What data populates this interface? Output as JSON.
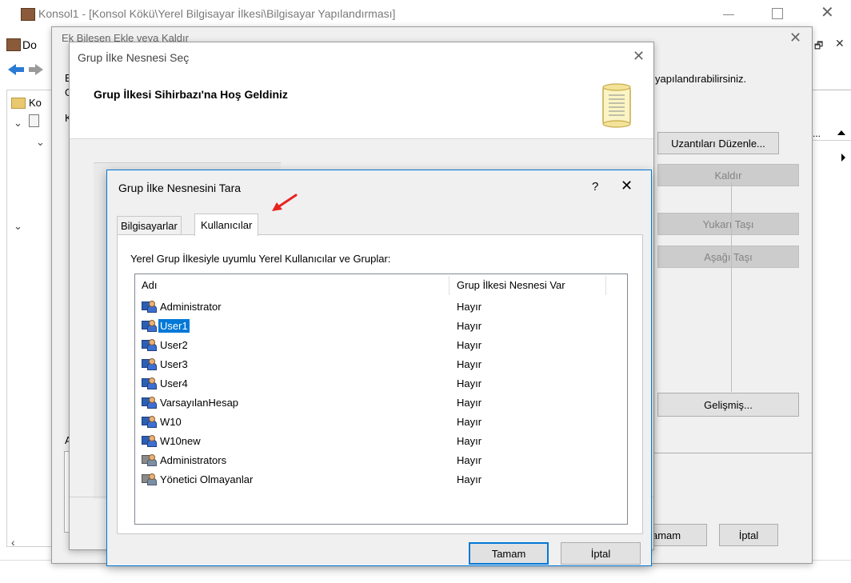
{
  "main_window": {
    "title": "Konsol1 - [Konsol Kökü\\Yerel Bilgisayar İlkesi\\Bilgisayar Yapılandırması]",
    "menu_first": "Do",
    "tree_item": "Ko",
    "col_trunc": "...",
    "right_partial_text": "yapılandırabilirsiniz."
  },
  "add_remove_dialog": {
    "title": "Ek Bileşen Ekle veya Kaldır",
    "left_letter_e": "E",
    "left_letter_g": "G",
    "left_letter_k": "K",
    "left_letter_a": "A",
    "buttons": {
      "edit_extensions": "Uzantıları Düzenle...",
      "remove": "Kaldır",
      "move_up": "Yukarı Taşı",
      "move_down": "Aşağı Taşı",
      "advanced": "Gelişmiş...",
      "ok_partial": "amam",
      "cancel": "İptal"
    }
  },
  "gpo_select_dialog": {
    "title": "Grup İlke Nesnesi Seç",
    "heading": "Grup İlkesi Sihirbazı'na Hoş Geldiniz"
  },
  "browse_dialog": {
    "title": "Grup İlke Nesnesini Tara",
    "help": "?",
    "tabs": [
      {
        "label": "Bilgisayarlar",
        "active": false
      },
      {
        "label": "Kullanıcılar",
        "active": true
      }
    ],
    "list_caption": "Yerel Grup İlkesiyle uyumlu Yerel Kullanıcılar ve Gruplar:",
    "columns": {
      "name": "Adı",
      "has_gpo": "Grup İlkesi Nesnesi Var"
    },
    "rows": [
      {
        "name": "Administrator",
        "value": "Hayır",
        "icon": "user-icon"
      },
      {
        "name": "User1",
        "value": "Hayır",
        "icon": "user-icon",
        "selected": true
      },
      {
        "name": "User2",
        "value": "Hayır",
        "icon": "user-icon"
      },
      {
        "name": "User3",
        "value": "Hayır",
        "icon": "user-icon"
      },
      {
        "name": "User4",
        "value": "Hayır",
        "icon": "user-icon"
      },
      {
        "name": "VarsayılanHesap",
        "value": "Hayır",
        "icon": "user-icon"
      },
      {
        "name": "W10",
        "value": "Hayır",
        "icon": "user-icon"
      },
      {
        "name": "W10new",
        "value": "Hayır",
        "icon": "user-icon"
      },
      {
        "name": "Administrators",
        "value": "Hayır",
        "icon": "group-icon"
      },
      {
        "name": "Yönetici Olmayanlar",
        "value": "Hayır",
        "icon": "group-icon"
      }
    ],
    "ok": "Tamam",
    "cancel": "İptal"
  },
  "colors": {
    "accent": "#0078d7",
    "annotation_arrow": "#e8231f"
  }
}
